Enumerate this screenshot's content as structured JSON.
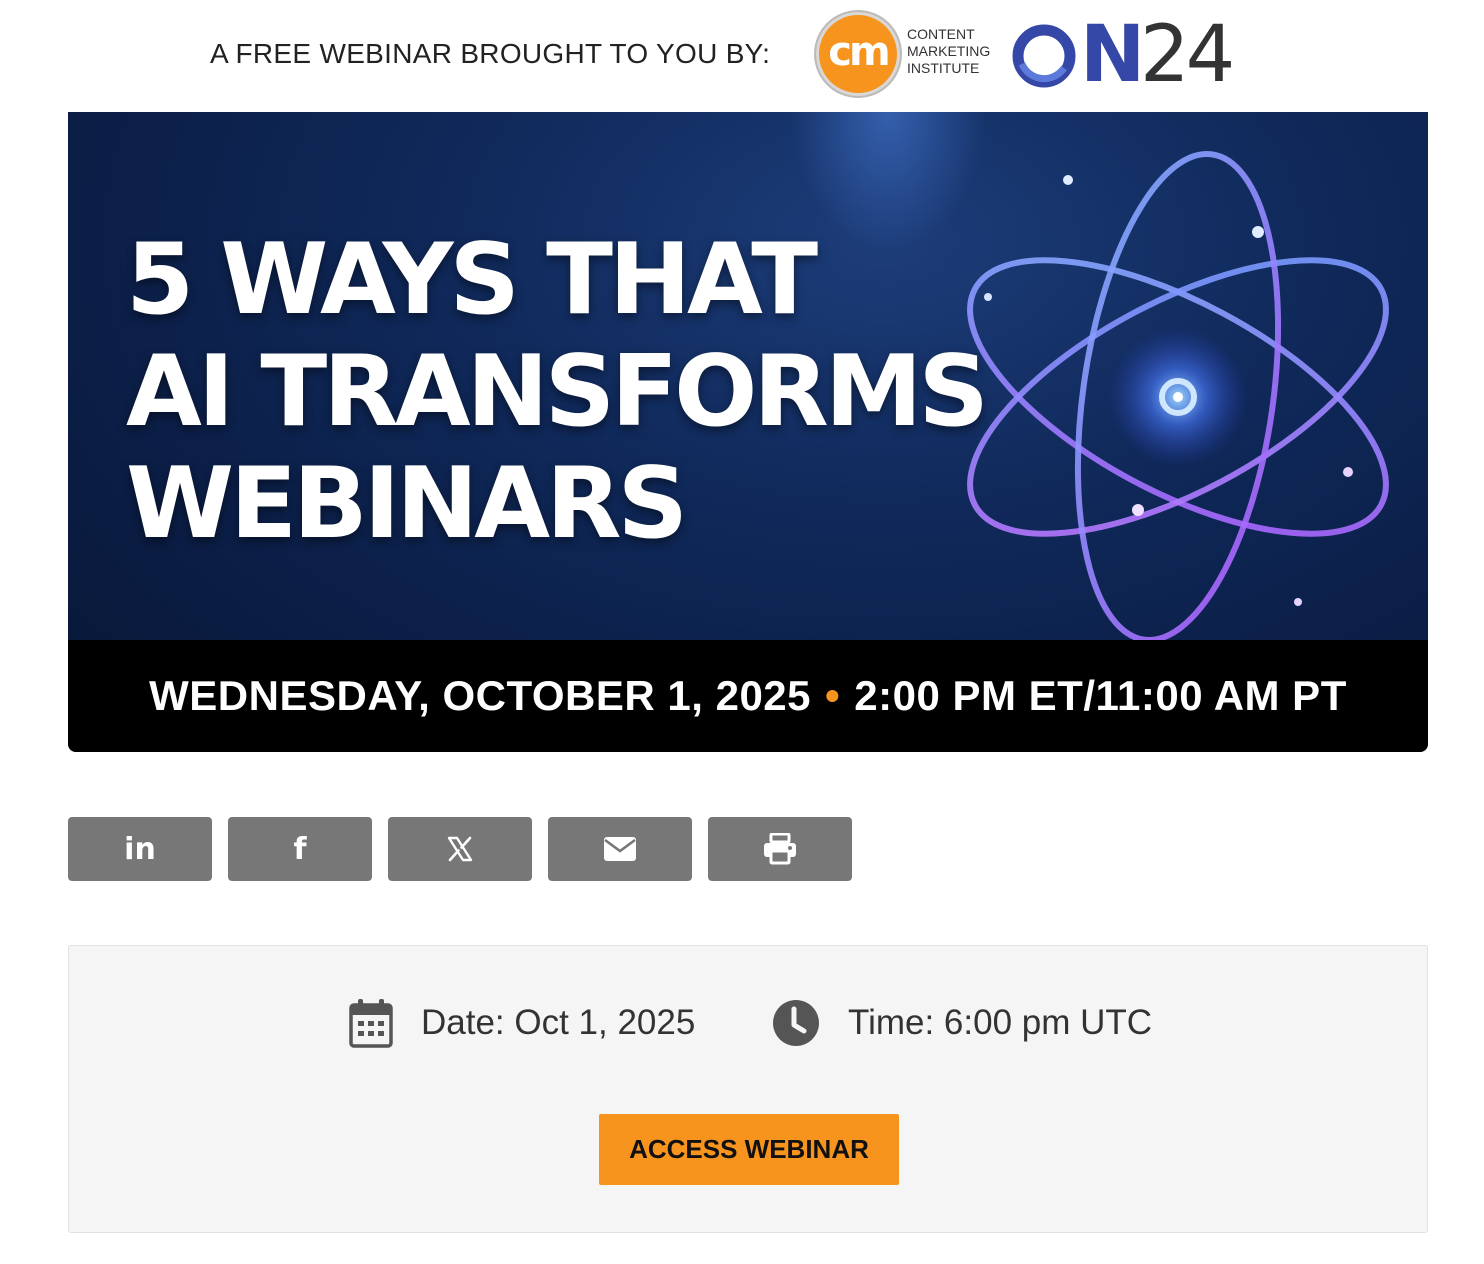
{
  "sponsor": {
    "text": "A FREE WEBINAR BROUGHT TO YOU BY:",
    "cmi_logo": {
      "initials": "cm",
      "line1": "CONTENT",
      "line2": "MARKETING",
      "line3": "INSTITUTE"
    },
    "on24_logo": {
      "letter": "N",
      "number": "24"
    }
  },
  "banner": {
    "title_lines": [
      "5 WAYS THAT",
      "AI TRANSFORMS",
      "WEBINARS"
    ],
    "date_text": "WEDNESDAY, OCTOBER 1, 2025",
    "separator": "•",
    "time_text": "2:00 PM ET/11:00 AM PT",
    "accent_color": "#f7941d"
  },
  "share": {
    "buttons": [
      {
        "label": "in",
        "icon": "linkedin-icon"
      },
      {
        "label": "f",
        "icon": "facebook-icon"
      },
      {
        "label": "",
        "icon": "x-icon"
      },
      {
        "label": "",
        "icon": "email-icon"
      },
      {
        "label": "",
        "icon": "print-icon"
      }
    ],
    "button_color": "#777777"
  },
  "event": {
    "date_label": "Date: Oct 1, 2025",
    "time_label": "Time: 6:00 pm UTC",
    "access_button": "ACCESS WEBINAR",
    "access_color": "#f7941d",
    "date_icon": "calendar-icon",
    "time_icon": "clock-icon"
  }
}
